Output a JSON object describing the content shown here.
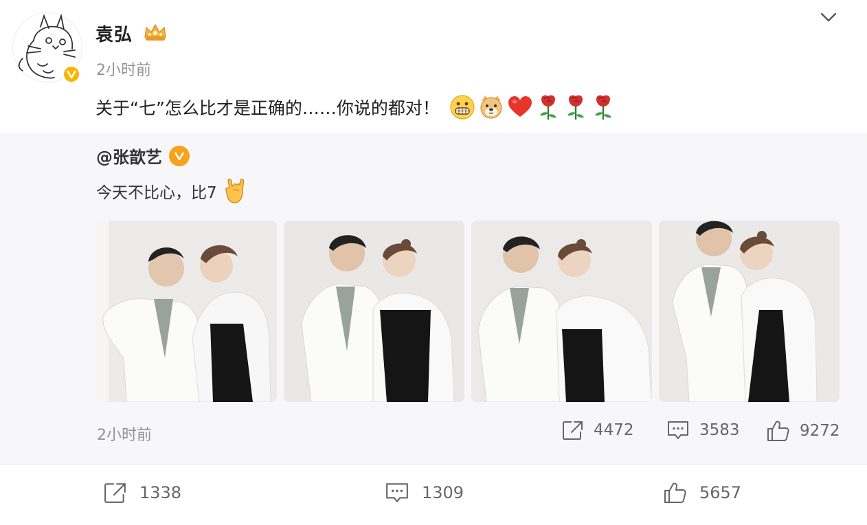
{
  "post": {
    "author": "袁弘",
    "time": "2小时前",
    "text": "关于“七”怎么比才是正确的……你说的都对！",
    "emojis": [
      "grin-icon",
      "doge-icon",
      "heart-icon",
      "rose-icon",
      "rose-icon",
      "rose-icon"
    ]
  },
  "repost": {
    "author": "@张歆艺",
    "text": "今天不比心，比7",
    "time": "2小时前",
    "photos": [
      "photo-1",
      "photo-2",
      "photo-3",
      "photo-4"
    ],
    "shares": "4472",
    "comments": "3583",
    "likes": "9272"
  },
  "actions": {
    "shares": "1338",
    "comments": "1309",
    "likes": "5657"
  },
  "colors": {
    "verified_gold": "#f7b500",
    "repost_bg": "#f7f7f9",
    "heart_red": "#e8342b"
  }
}
